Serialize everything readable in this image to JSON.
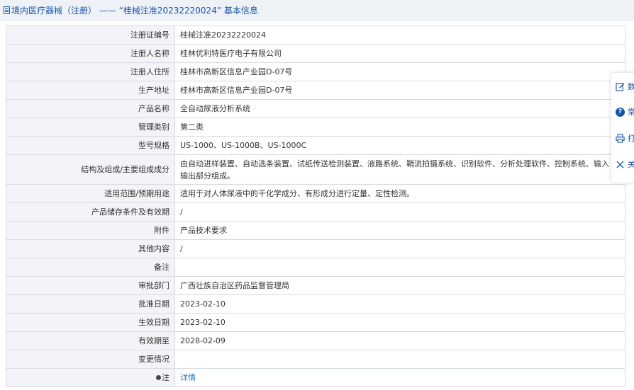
{
  "header": {
    "title": "境内医疗器械（注册） —— “桂械注准20232220024” 基本信息"
  },
  "rows": [
    {
      "label": "注册证编号",
      "value": "桂械注准20232220024"
    },
    {
      "label": "注册人名称",
      "value": "桂林优利特医疗电子有限公司"
    },
    {
      "label": "注册人住所",
      "value": "桂林市高新区信息产业园D-07号"
    },
    {
      "label": "生产地址",
      "value": "桂林市高新区信息产业园D-07号"
    },
    {
      "label": "产品名称",
      "value": "全自动尿液分析系统"
    },
    {
      "label": "管理类别",
      "value": "第二类"
    },
    {
      "label": "型号规格",
      "value": "US-1000、US-1000B、US-1000C"
    },
    {
      "label": "结构及组成/主要组成成分",
      "value": "由自动进样装置、自动选条装置、试纸传送检测装置、液路系统、鞘流拍摄系统、识别软件、分析处理软件、控制系统、输入输出部分组成。"
    },
    {
      "label": "适用范围/预期用途",
      "value": "适用于对人体尿液中的干化学成分、有形成分进行定量、定性检测。"
    },
    {
      "label": "产品储存条件及有效期",
      "value": "/"
    },
    {
      "label": "附件",
      "value": "产品技术要求"
    },
    {
      "label": "其他内容",
      "value": "/"
    },
    {
      "label": "备注",
      "value": ""
    },
    {
      "label": "审批部门",
      "value": "广西壮族自治区药品监督管理局"
    },
    {
      "label": "批准日期",
      "value": "2023-02-10"
    },
    {
      "label": "生效日期",
      "value": "2023-02-10"
    },
    {
      "label": "有效期至",
      "value": "2028-02-09"
    },
    {
      "label": "变更情况",
      "value": ""
    },
    {
      "label": "注",
      "value": "详情"
    }
  ],
  "toolbar": {
    "edit_label": "数",
    "help_label": "常",
    "print_label": "打",
    "close_label": "关"
  },
  "colors": {
    "accent": "#1a56a8",
    "link": "#2a7ab8",
    "label_bg": "#f2f4f7",
    "border": "#d6dbe2"
  }
}
